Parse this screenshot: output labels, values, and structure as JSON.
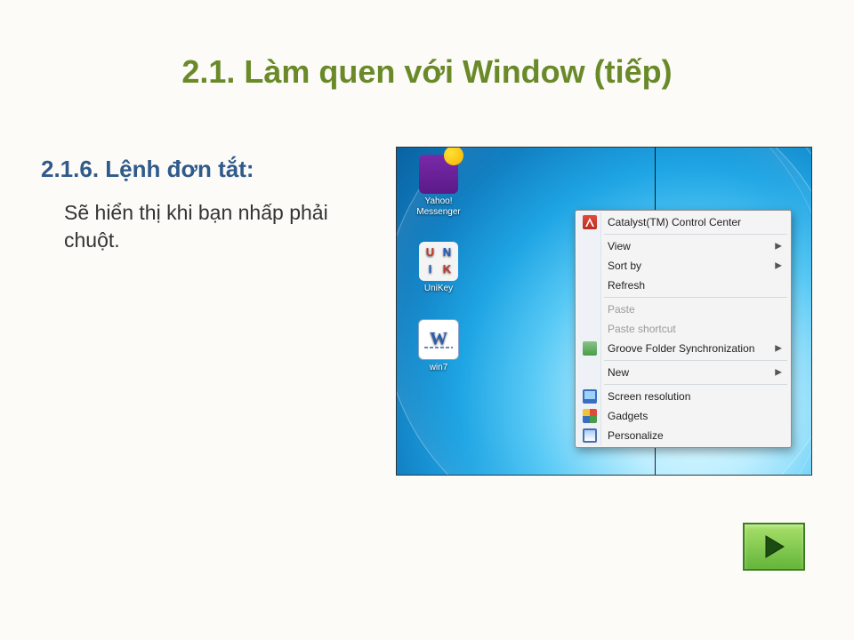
{
  "title": "2.1. Làm quen với Window (tiếp)",
  "subtitle": "2.1.6. Lệnh đơn tắt:",
  "body": "Sẽ hiển thị khi bạn nhấp phải chuột.",
  "desktop_icons": [
    {
      "label": "Yahoo! Messenger"
    },
    {
      "label": "UniKey"
    },
    {
      "label": "win7"
    }
  ],
  "context_menu": {
    "groups": [
      [
        {
          "label": "Catalyst(TM) Control Center",
          "icon": "ati",
          "enabled": true,
          "submenu": false
        }
      ],
      [
        {
          "label": "View",
          "icon": "",
          "enabled": true,
          "submenu": true
        },
        {
          "label": "Sort by",
          "icon": "",
          "enabled": true,
          "submenu": true
        },
        {
          "label": "Refresh",
          "icon": "",
          "enabled": true,
          "submenu": false
        }
      ],
      [
        {
          "label": "Paste",
          "icon": "",
          "enabled": false,
          "submenu": false
        },
        {
          "label": "Paste shortcut",
          "icon": "",
          "enabled": false,
          "submenu": false
        },
        {
          "label": "Groove Folder Synchronization",
          "icon": "groove",
          "enabled": true,
          "submenu": true
        }
      ],
      [
        {
          "label": "New",
          "icon": "",
          "enabled": true,
          "submenu": true
        }
      ],
      [
        {
          "label": "Screen resolution",
          "icon": "screen",
          "enabled": true,
          "submenu": false
        },
        {
          "label": "Gadgets",
          "icon": "gadget",
          "enabled": true,
          "submenu": false
        },
        {
          "label": "Personalize",
          "icon": "pers",
          "enabled": true,
          "submenu": false
        }
      ]
    ]
  },
  "next_button": {
    "label": "Next"
  }
}
